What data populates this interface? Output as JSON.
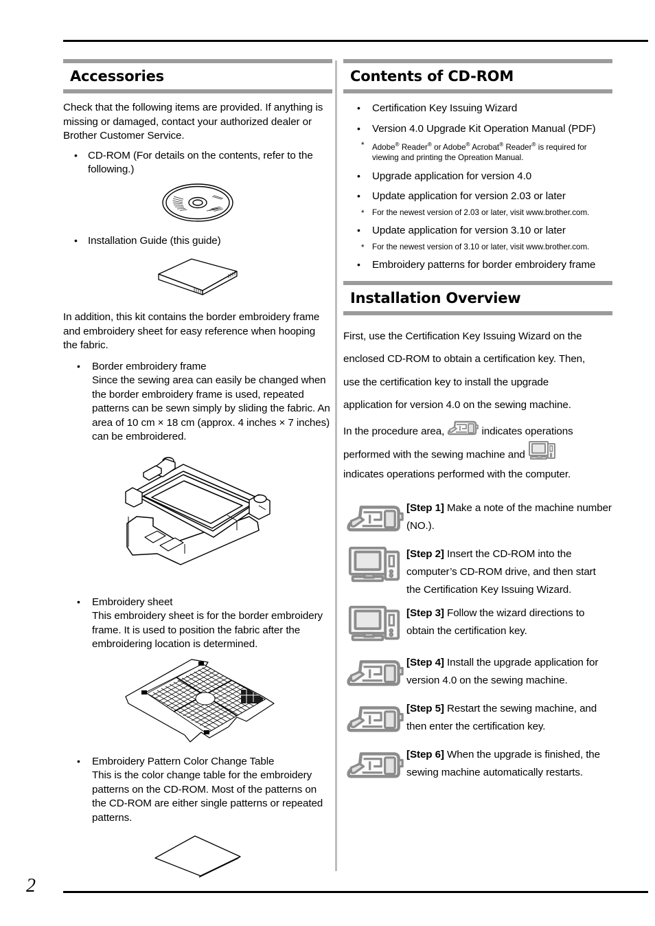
{
  "page": {
    "number": "2"
  },
  "left_column": {
    "heading": "Accessories",
    "intro": "Check that the following items are provided. If anything is missing or damaged, contact your authorized dealer or Brother Customer Service.",
    "items": [
      {
        "label": "CD-ROM (For details on the contents, refer to the following.)",
        "figure": "cd-rom-disc-illustration"
      },
      {
        "label": "Installation Guide (this guide)",
        "figure": "installation-guide-booklet-illustration"
      }
    ],
    "second_para": "In addition, this kit contains the border embroidery frame and embroidery sheet for easy reference when hooping the fabric.",
    "detail_items": [
      {
        "title": "Border embroidery frame",
        "body": "Since the sewing area can easily be changed when the border embroidery frame is used, repeated patterns can be sewn simply by sliding the fabric. An area of 10 cm × 18 cm (approx. 4 inches × 7 inches) can be embroidered.",
        "figure": "border-embroidery-frame-illustration"
      },
      {
        "title": "Embroidery sheet",
        "body": "This embroidery sheet is for the border embroidery frame. It is used to position the fabric after the embroidering location is determined.",
        "figure": "embroidery-sheet-illustration"
      },
      {
        "title": "Embroidery Pattern Color Change Table",
        "body": "This is the color change table for the embroidery patterns on the CD-ROM. Most of the patterns on the CD-ROM are either single patterns or repeated patterns.",
        "figure": "color-change-table-sheet-illustration"
      }
    ]
  },
  "right_column": {
    "cd_heading": "Contents of CD-ROM",
    "cd_items": [
      {
        "label": "Certification Key Issuing Wizard"
      },
      {
        "label": "Version 4.0 Upgrade Kit Operation Manual (PDF)"
      },
      {
        "label": "Upgrade application for version 4.0"
      },
      {
        "label": "Update application for version 2.03 or later"
      },
      {
        "label": "Update application for version 3.10 or later"
      },
      {
        "label": "Embroidery patterns for border embroidery frame"
      }
    ],
    "notes": {
      "adobe_1": "Adobe",
      "adobe_2": "Reader",
      "adobe_3": "or Adobe",
      "adobe_4": "Acrobat",
      "adobe_5": "Reader",
      "adobe_6": "is required for viewing and printing the Opreation Manual.",
      "reg": "®",
      "newest_203": "For the newest version of 2.03 or later, visit www.brother.com.",
      "newest_310": "For the newest version of 3.10 or later, visit www.brother.com."
    },
    "overview_heading": "Installation Overview",
    "overview_lines": [
      "First, use the Certification Key Issuing Wizard on the",
      "enclosed CD-ROM to obtain a certification key. Then,",
      "use the certification key to install the upgrade",
      "application for version 4.0 on the sewing machine."
    ],
    "overview_icon_line_1a": "In the procedure area,",
    "overview_icon_line_1b": "indicates operations",
    "overview_icon_line_2a": "performed with the sewing machine and",
    "overview_icon_line_3": "indicates operations performed with the computer.",
    "steps": [
      {
        "label": "[Step 1]",
        "tag": "Step 1",
        "text": "Make a note of the machine number (NO.).",
        "icon": "sewing-machine-icon"
      },
      {
        "label": "[Step 2]",
        "tag": "Step 2",
        "text": "Insert the CD-ROM into the computer’s CD-ROM drive, and then start the Certification Key Issuing Wizard.",
        "icon": "computer-icon"
      },
      {
        "label": "[Step 3]",
        "tag": "Step 3",
        "text": "Follow the wizard directions to obtain the certification key.",
        "icon": "computer-icon"
      },
      {
        "label": "[Step 4]",
        "tag": "Step 4",
        "text": "Install the upgrade application for version 4.0 on the sewing machine.",
        "icon": "sewing-machine-icon"
      },
      {
        "label": "[Step 5]",
        "tag": "Step 5",
        "text": "Restart the sewing machine, and then enter the certification key.",
        "icon": "sewing-machine-icon"
      },
      {
        "label": "[Step 6]",
        "tag": "Step 6",
        "text": "When the upgrade is finished, the sewing machine automatically restarts.",
        "icon": "sewing-machine-icon"
      }
    ]
  },
  "colors": {
    "heading_bar": "#9b9b9b",
    "rule": "#000000",
    "divider": "#bdbdbd",
    "icon_outline": "#8c8c8c"
  }
}
